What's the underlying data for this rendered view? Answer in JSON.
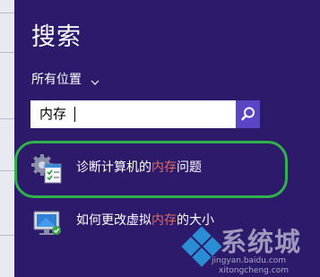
{
  "search_pane": {
    "title": "搜索",
    "scope_label": "所有位置",
    "query": "内存",
    "search_button_icon": "magnifier-icon"
  },
  "results": [
    {
      "before": "诊断计算机的",
      "match": "内存",
      "after": "问题",
      "icon": "memory-diagnostic-icon",
      "highlighted": true
    },
    {
      "before": "如何更改虚拟",
      "match": "内存",
      "after": "的大小",
      "icon": "system-monitor-icon",
      "highlighted": false
    }
  ],
  "watermark": {
    "text": "系统城",
    "url_top": "jingyan.baidu.com",
    "url_bottom": "xitongcheng.com"
  },
  "colors": {
    "background": "#2d1a6b",
    "accent": "#5b45c4",
    "highlight_oval": "#2fb34a",
    "match_text": "#d96a6a"
  }
}
